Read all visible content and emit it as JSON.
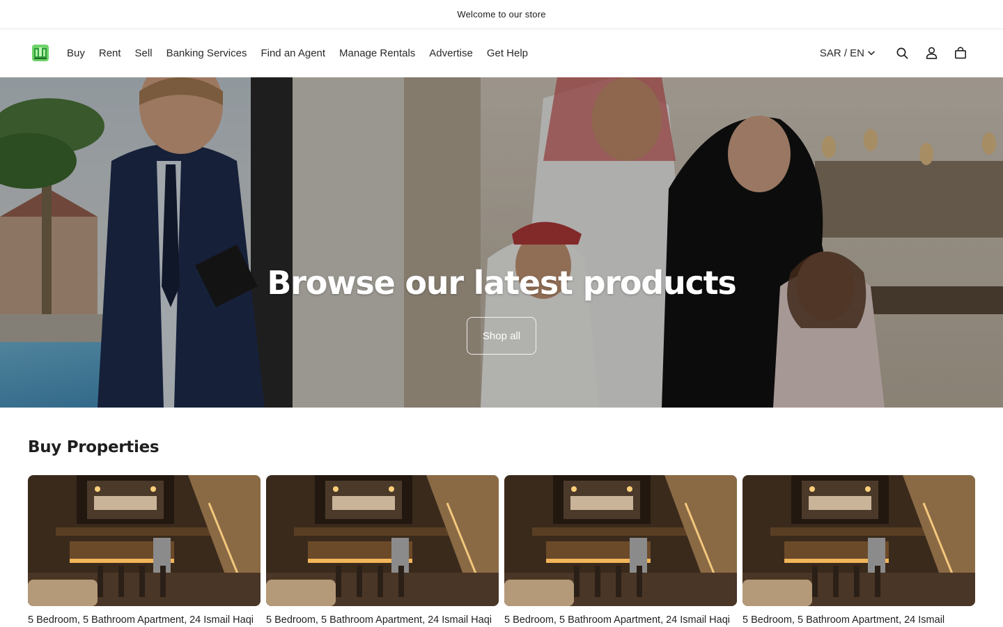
{
  "announcement": {
    "text": "Welcome to our store"
  },
  "header": {
    "nav": [
      {
        "label": "Buy"
      },
      {
        "label": "Rent"
      },
      {
        "label": "Sell"
      },
      {
        "label": "Banking Services"
      },
      {
        "label": "Find an Agent"
      },
      {
        "label": "Manage Rentals"
      },
      {
        "label": "Advertise"
      },
      {
        "label": "Get Help"
      }
    ],
    "locale": "SAR / EN",
    "icons": [
      "search-icon",
      "account-icon",
      "cart-icon"
    ]
  },
  "hero": {
    "title": "Browse our latest products",
    "button_label": "Shop all"
  },
  "section": {
    "title": "Buy Properties",
    "products": [
      {
        "title": "5 Bedroom, 5 Bathroom Apartment, 24 Ismail Haqi"
      },
      {
        "title": "5 Bedroom, 5 Bathroom Apartment, 24 Ismail Haqi"
      },
      {
        "title": "5 Bedroom, 5 Bathroom Apartment, 24 Ismail Haqi"
      },
      {
        "title": "5 Bedroom, 5 Bathroom Apartment, 24 Ismail"
      }
    ]
  },
  "colors": {
    "logo": "#3cb043",
    "overlay": "#000000"
  }
}
